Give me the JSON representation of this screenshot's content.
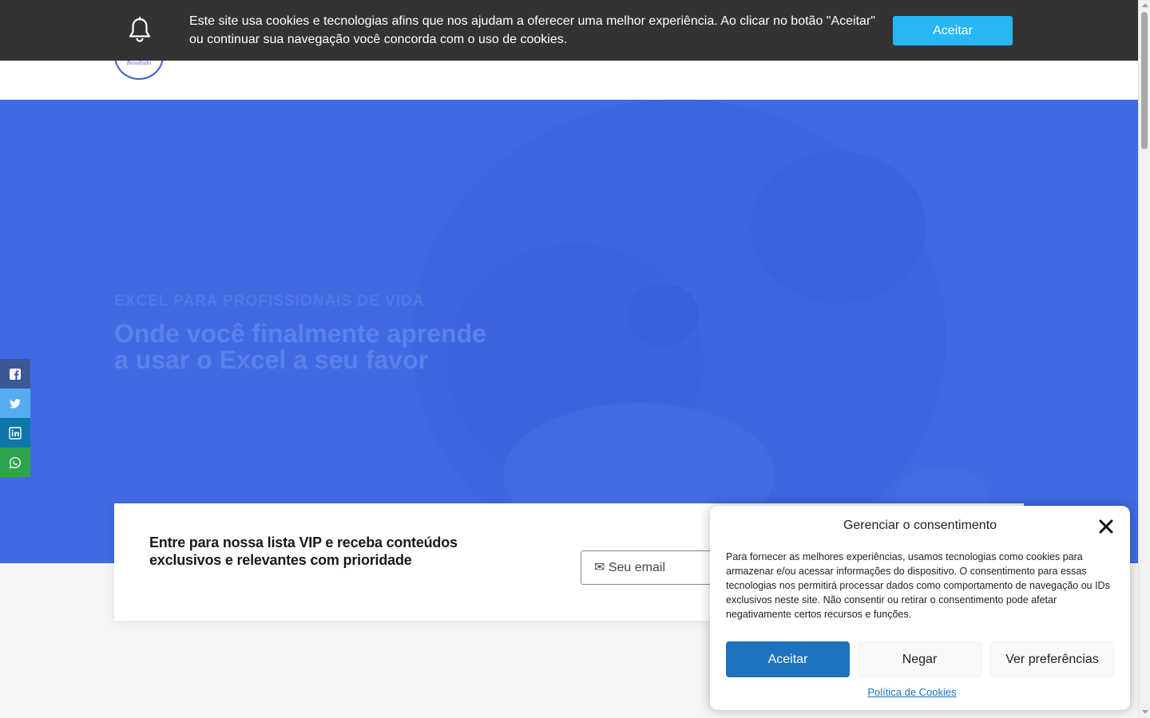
{
  "header": {
    "logo_text": "Resultado"
  },
  "hero": {
    "eyebrow": "EXCEL PARA PROFISSIONAIS DE VIDA",
    "title": "Onde você finalmente aprende a usar o Excel a seu favor"
  },
  "social": {
    "items": [
      {
        "name": "facebook",
        "icon": "facebook-icon"
      },
      {
        "name": "twitter",
        "icon": "twitter-icon"
      },
      {
        "name": "linkedin",
        "icon": "linkedin-icon"
      },
      {
        "name": "whatsapp",
        "icon": "whatsapp-icon"
      }
    ]
  },
  "newsletter": {
    "text": "Entre para nossa lista VIP e receba conteúdos exclusivos e relevantes com prioridade",
    "email_placeholder": "✉ Seu email"
  },
  "cookie_bar": {
    "text": "Este site usa cookies e tecnologias afins que nos ajudam a oferecer uma melhor experiência. Ao clicar no botão \"Aceitar\" ou continuar sua navegação você concorda com o uso de cookies.",
    "accept_label": "Aceitar",
    "accent_color": "#29b6f6"
  },
  "consent": {
    "title": "Gerenciar o consentimento",
    "body": "Para fornecer as melhores experiências, usamos tecnologias como cookies para armazenar e/ou acessar informações do dispositivo. O consentimento para essas tecnologias nos permitirá processar dados como comportamento de navegação ou IDs exclusivos neste site. Não consentir ou retirar o consentimento pode afetar negativamente certos recursos e funções.",
    "accept_label": "Aceitar",
    "deny_label": "Negar",
    "prefs_label": "Ver preferências",
    "policy_link": "Política de Cookies",
    "primary_color": "#1e73be"
  },
  "colors": {
    "hero_bg": "#4169e1",
    "cookie_bar_bg": "#333333"
  }
}
